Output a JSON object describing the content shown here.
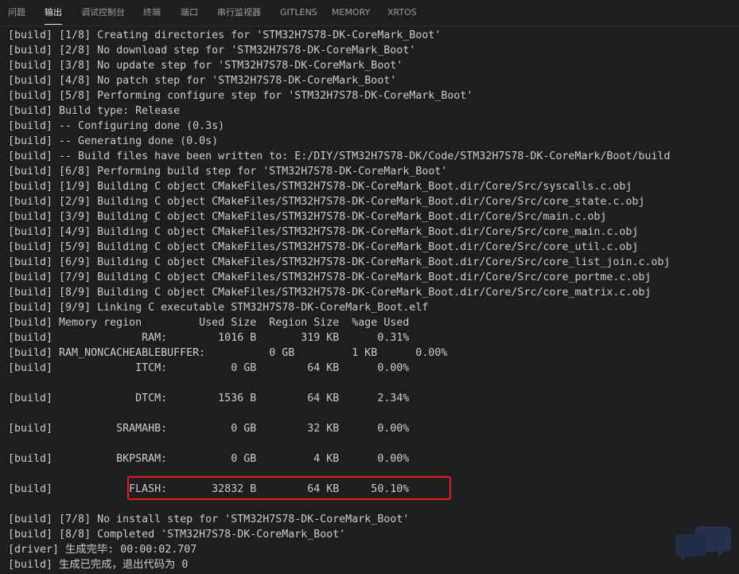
{
  "tabs": [
    {
      "label": "问题"
    },
    {
      "label": "输出",
      "active": true
    },
    {
      "label": "调试控制台"
    },
    {
      "label": "终端"
    },
    {
      "label": "端口"
    },
    {
      "label": "串行监视器"
    },
    {
      "label": "GITLENS"
    },
    {
      "label": "MEMORY"
    },
    {
      "label": "XRTOS"
    }
  ],
  "output_lines": [
    "[build] [1/8] Creating directories for 'STM32H7S78-DK-CoreMark_Boot'",
    "[build] [2/8] No download step for 'STM32H7S78-DK-CoreMark_Boot'",
    "[build] [3/8] No update step for 'STM32H7S78-DK-CoreMark_Boot'",
    "[build] [4/8] No patch step for 'STM32H7S78-DK-CoreMark_Boot'",
    "[build] [5/8] Performing configure step for 'STM32H7S78-DK-CoreMark_Boot'",
    "[build] Build type: Release",
    "[build] -- Configuring done (0.3s)",
    "[build] -- Generating done (0.0s)",
    "[build] -- Build files have been written to: E:/DIY/STM32H7S78-DK/Code/STM32H7S78-DK-CoreMark/Boot/build",
    "[build] [6/8] Performing build step for 'STM32H7S78-DK-CoreMark_Boot'",
    "[build] [1/9] Building C object CMakeFiles/STM32H7S78-DK-CoreMark_Boot.dir/Core/Src/syscalls.c.obj",
    "[build] [2/9] Building C object CMakeFiles/STM32H7S78-DK-CoreMark_Boot.dir/Core/Src/core_state.c.obj",
    "[build] [3/9] Building C object CMakeFiles/STM32H7S78-DK-CoreMark_Boot.dir/Core/Src/main.c.obj",
    "[build] [4/9] Building C object CMakeFiles/STM32H7S78-DK-CoreMark_Boot.dir/Core/Src/core_main.c.obj",
    "[build] [5/9] Building C object CMakeFiles/STM32H7S78-DK-CoreMark_Boot.dir/Core/Src/core_util.c.obj",
    "[build] [6/9] Building C object CMakeFiles/STM32H7S78-DK-CoreMark_Boot.dir/Core/Src/core_list_join.c.obj",
    "[build] [7/9] Building C object CMakeFiles/STM32H7S78-DK-CoreMark_Boot.dir/Core/Src/core_portme.c.obj",
    "[build] [8/9] Building C object CMakeFiles/STM32H7S78-DK-CoreMark_Boot.dir/Core/Src/core_matrix.c.obj",
    "[build] [9/9] Linking C executable STM32H7S78-DK-CoreMark_Boot.elf",
    "[build] Memory region         Used Size  Region Size  %age Used",
    "[build]              RAM:        1016 B       319 KB      0.31%",
    "[build] RAM_NONCACHEABLEBUFFER:          0 GB         1 KB      0.00%",
    "[build]             ITCM:          0 GB        64 KB      0.00%",
    "",
    "[build]             DTCM:        1536 B        64 KB      2.34%",
    "",
    "[build]          SRAMAHB:          0 GB        32 KB      0.00%",
    "",
    "[build]          BKPSRAM:          0 GB         4 KB      0.00%",
    "",
    "[build]            FLASH:       32832 B        64 KB     50.10%",
    "",
    "[build] [7/8] No install step for 'STM32H7S78-DK-CoreMark_Boot'",
    "[build] [8/8] Completed 'STM32H7S78-DK-CoreMark_Boot'",
    "[driver] 生成完毕: 00:00:02.707",
    "[build] 生成已完成，退出代码为 0"
  ],
  "colors": {
    "background": "#1e1e1e",
    "text": "#cccccc",
    "highlight_border": "#e51c23"
  }
}
